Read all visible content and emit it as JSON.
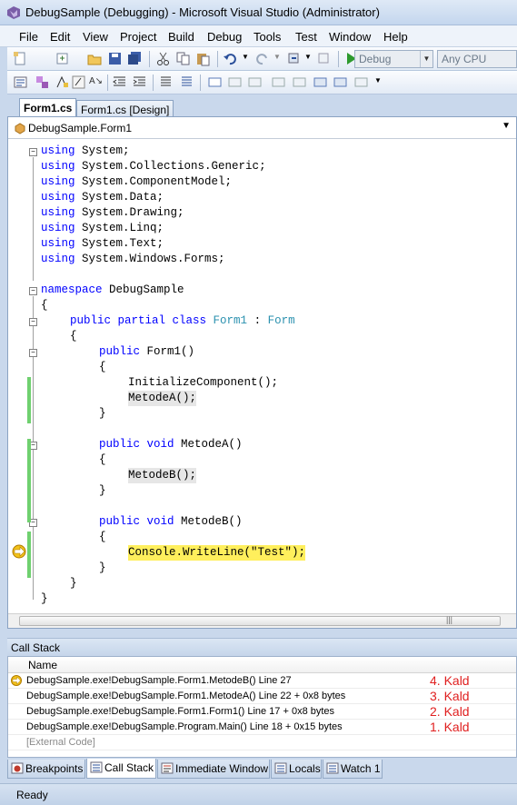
{
  "window": {
    "title": "DebugSample (Debugging) - Microsoft Visual Studio (Administrator)"
  },
  "menu": [
    "File",
    "Edit",
    "View",
    "Project",
    "Build",
    "Debug",
    "Tools",
    "Test",
    "Window",
    "Help"
  ],
  "toolbar": {
    "config_value": "Debug",
    "platform_value": "Any CPU"
  },
  "doc_tabs": [
    "Form1.cs",
    "Form1.cs [Design]"
  ],
  "navbar": {
    "type_selection": "DebugSample.Form1"
  },
  "code": {
    "using_kw": "using",
    "usings": [
      "System;",
      "System.Collections.Generic;",
      "System.ComponentModel;",
      "System.Data;",
      "System.Drawing;",
      "System.Linq;",
      "System.Text;",
      "System.Windows.Forms;"
    ],
    "namespace_kw": "namespace",
    "namespace_name": "DebugSample",
    "open_brace": "{",
    "close_brace": "}",
    "class_kw": "public partial class",
    "class_name": "Form1",
    "colon": ":",
    "base_class": "Form",
    "ctor_kw": "public",
    "ctor_sig": "Form1()",
    "init_call": "InitializeComponent();",
    "call_a": "MetodeA();",
    "method_kw": "public void",
    "method_a_sig": "MetodeA()",
    "call_b": "MetodeB();",
    "method_b_sig": "MetodeB()",
    "current_stmt": "Console.WriteLine(\"Test\");"
  },
  "call_stack": {
    "title": "Call Stack",
    "column_name": "Name",
    "rows": [
      {
        "text": "DebugSample.exe!DebugSample.Form1.MetodeB() Line 27",
        "note": "4. Kald"
      },
      {
        "text": "DebugSample.exe!DebugSample.Form1.MetodeA() Line 22 + 0x8 bytes",
        "note": "3. Kald"
      },
      {
        "text": "DebugSample.exe!DebugSample.Form1.Form1() Line 17 + 0x8 bytes",
        "note": "2. Kald"
      },
      {
        "text": "DebugSample.exe!DebugSample.Program.Main() Line 18 + 0x15 bytes",
        "note": "1. Kald"
      },
      {
        "text": "[External Code]",
        "note": ""
      }
    ]
  },
  "bottom_tabs": [
    "Breakpoints",
    "Call Stack",
    "Immediate Window",
    "Locals",
    "Watch 1"
  ],
  "status": "Ready",
  "colors": {
    "current_line": "#ffef5c",
    "annotation": "#e02020",
    "keyword": "#0000ff",
    "type": "#2b91af"
  }
}
